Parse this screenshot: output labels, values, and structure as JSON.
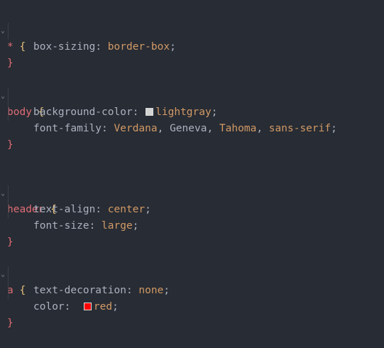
{
  "editor": {
    "language": "css",
    "blocks": [
      {
        "selector": "*",
        "open": "{",
        "close": "}",
        "declarations": [
          {
            "property": "box-sizing",
            "values": [
              "border-box"
            ]
          }
        ]
      },
      {
        "selector": "body",
        "open": "{",
        "close": "}",
        "declarations": [
          {
            "property": "background-color",
            "swatch": "#d3d3d3",
            "values": [
              "lightgray"
            ]
          },
          {
            "property": "font-family",
            "values": [
              "Verdana",
              "Geneva",
              "Tahoma",
              "sans-serif"
            ]
          }
        ]
      },
      {
        "selector": "header",
        "open": "{",
        "close": "}",
        "declarations": [
          {
            "property": "text-align",
            "values": [
              "center"
            ]
          },
          {
            "property": "font-size",
            "values": [
              "large"
            ]
          }
        ]
      },
      {
        "selector": "a",
        "open": "{",
        "close": "}",
        "declarations": [
          {
            "property": "text-decoration",
            "values": [
              "none"
            ]
          },
          {
            "property": "color",
            "swatch": "#ff0000",
            "values": [
              "red"
            ]
          }
        ]
      }
    ],
    "fold_icon": "chevron-down-icon",
    "colors": {
      "background": "#282c34",
      "selector": "#e06c75",
      "value": "#d19a66",
      "property": "#abb2bf",
      "swatch_lightgray": "#d3d3d3",
      "swatch_red": "#ff0000"
    }
  }
}
